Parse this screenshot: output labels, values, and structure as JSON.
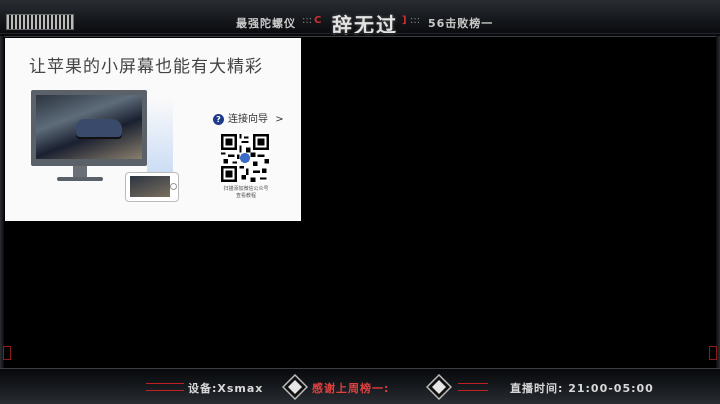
{
  "card": {
    "title": "让苹果的小屏幕也能有大精彩",
    "guide_label": "连接向导",
    "guide_chevron": ">",
    "qr_caption_line1": "扫描添加微信公众号",
    "qr_caption_line2": "查看教程"
  },
  "top": {
    "left_text": "最强陀螺仪",
    "left_dots": ":::",
    "bracket_left": "C",
    "main_title": "辞无过",
    "bracket_right": "]",
    "right_dots": ":::",
    "right_text": "56击败榜一"
  },
  "bottom": {
    "device_label": "设备:Xsmax",
    "thanks_label": "感谢上周榜一:",
    "schedule_label": "直播时间: 21:00-05:00"
  },
  "colors": {
    "accent_red": "#d23030",
    "frame_dark": "#15181c",
    "card_bg": "#fafafa",
    "help_icon_blue": "#1e3a8a"
  },
  "icons": [
    "help-circle-icon",
    "chevron-right-icon",
    "qr-code-icon",
    "diamond-emblem-icon",
    "monitor-illustration",
    "phone-illustration"
  ]
}
